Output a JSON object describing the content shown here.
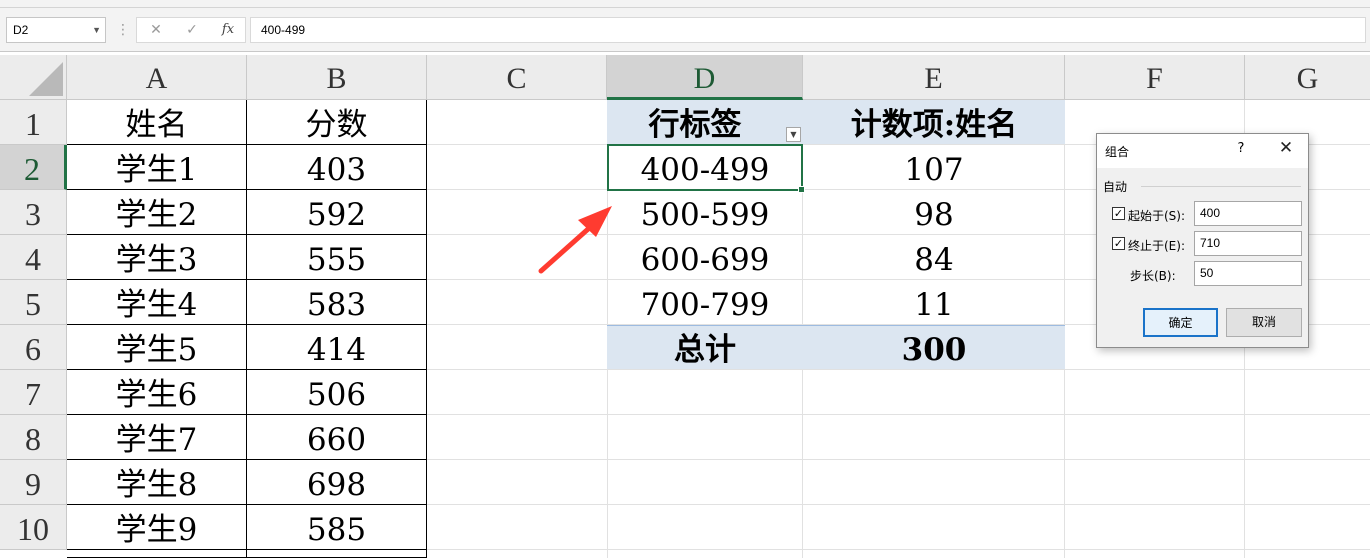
{
  "formula_bar": {
    "name_box": "D2",
    "separator": "⋮",
    "cancel_icon": "close-icon",
    "enter_icon": "check-icon",
    "fx_label": "fx",
    "formula_value": "400-499"
  },
  "sheet": {
    "columns": [
      "A",
      "B",
      "C",
      "D",
      "E",
      "F",
      "G"
    ],
    "selected_column": "D",
    "rows": [
      "1",
      "2",
      "3",
      "4",
      "5",
      "6",
      "7",
      "8",
      "9",
      "10"
    ],
    "selected_row": "2",
    "table": {
      "header": [
        "姓名",
        "分数"
      ],
      "rows": [
        [
          "学生1",
          "403"
        ],
        [
          "学生2",
          "592"
        ],
        [
          "学生3",
          "555"
        ],
        [
          "学生4",
          "583"
        ],
        [
          "学生5",
          "414"
        ],
        [
          "学生6",
          "506"
        ],
        [
          "学生7",
          "660"
        ],
        [
          "学生8",
          "698"
        ],
        [
          "学生9",
          "585"
        ]
      ]
    },
    "pivot": {
      "row_label_header": "行标签",
      "value_header": "计数项:姓名",
      "rows": [
        [
          "400-499",
          "107"
        ],
        [
          "500-599",
          "98"
        ],
        [
          "600-699",
          "84"
        ],
        [
          "700-799",
          "11"
        ]
      ],
      "total_label": "总计",
      "total_value": "300",
      "header_color": "#dce6f1"
    }
  },
  "dialog": {
    "title": "组合",
    "help": "?",
    "close": "✕",
    "group_label": "自动",
    "start_label": "起始于(S):",
    "start_value": "400",
    "start_checked": true,
    "end_label": "终止于(E):",
    "end_value": "710",
    "end_checked": true,
    "step_label": "步长(B):",
    "step_value": "50",
    "ok": "确定",
    "cancel": "取消"
  },
  "colors": {
    "selection_green": "#217346",
    "annotation_red": "#ff3b30",
    "dialog_primary": "#1a73c9"
  }
}
